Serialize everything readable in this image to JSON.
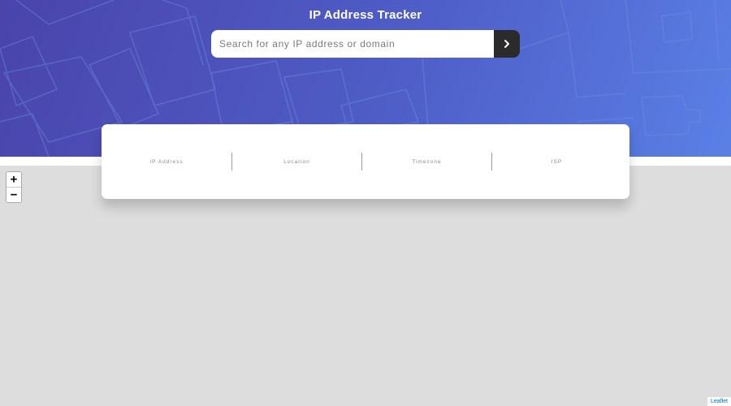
{
  "header": {
    "title": "IP Address Tracker"
  },
  "search": {
    "placeholder": "Search for any IP address or domain",
    "value": "",
    "button_icon": "chevron-right-icon"
  },
  "info_card": {
    "columns": [
      {
        "label": "IP Address",
        "value": ""
      },
      {
        "label": "Location",
        "value": ""
      },
      {
        "label": "Timezone",
        "value": ""
      },
      {
        "label": "ISP",
        "value": ""
      }
    ]
  },
  "map": {
    "zoom_in_label": "+",
    "zoom_out_label": "−",
    "attribution": "Leaflet"
  },
  "colors": {
    "hero_start": "#4a44ab",
    "hero_end": "#5a80e6",
    "button_bg": "#2b2b2b",
    "map_bg": "#dddddd",
    "attribution_link": "#0078a8"
  }
}
